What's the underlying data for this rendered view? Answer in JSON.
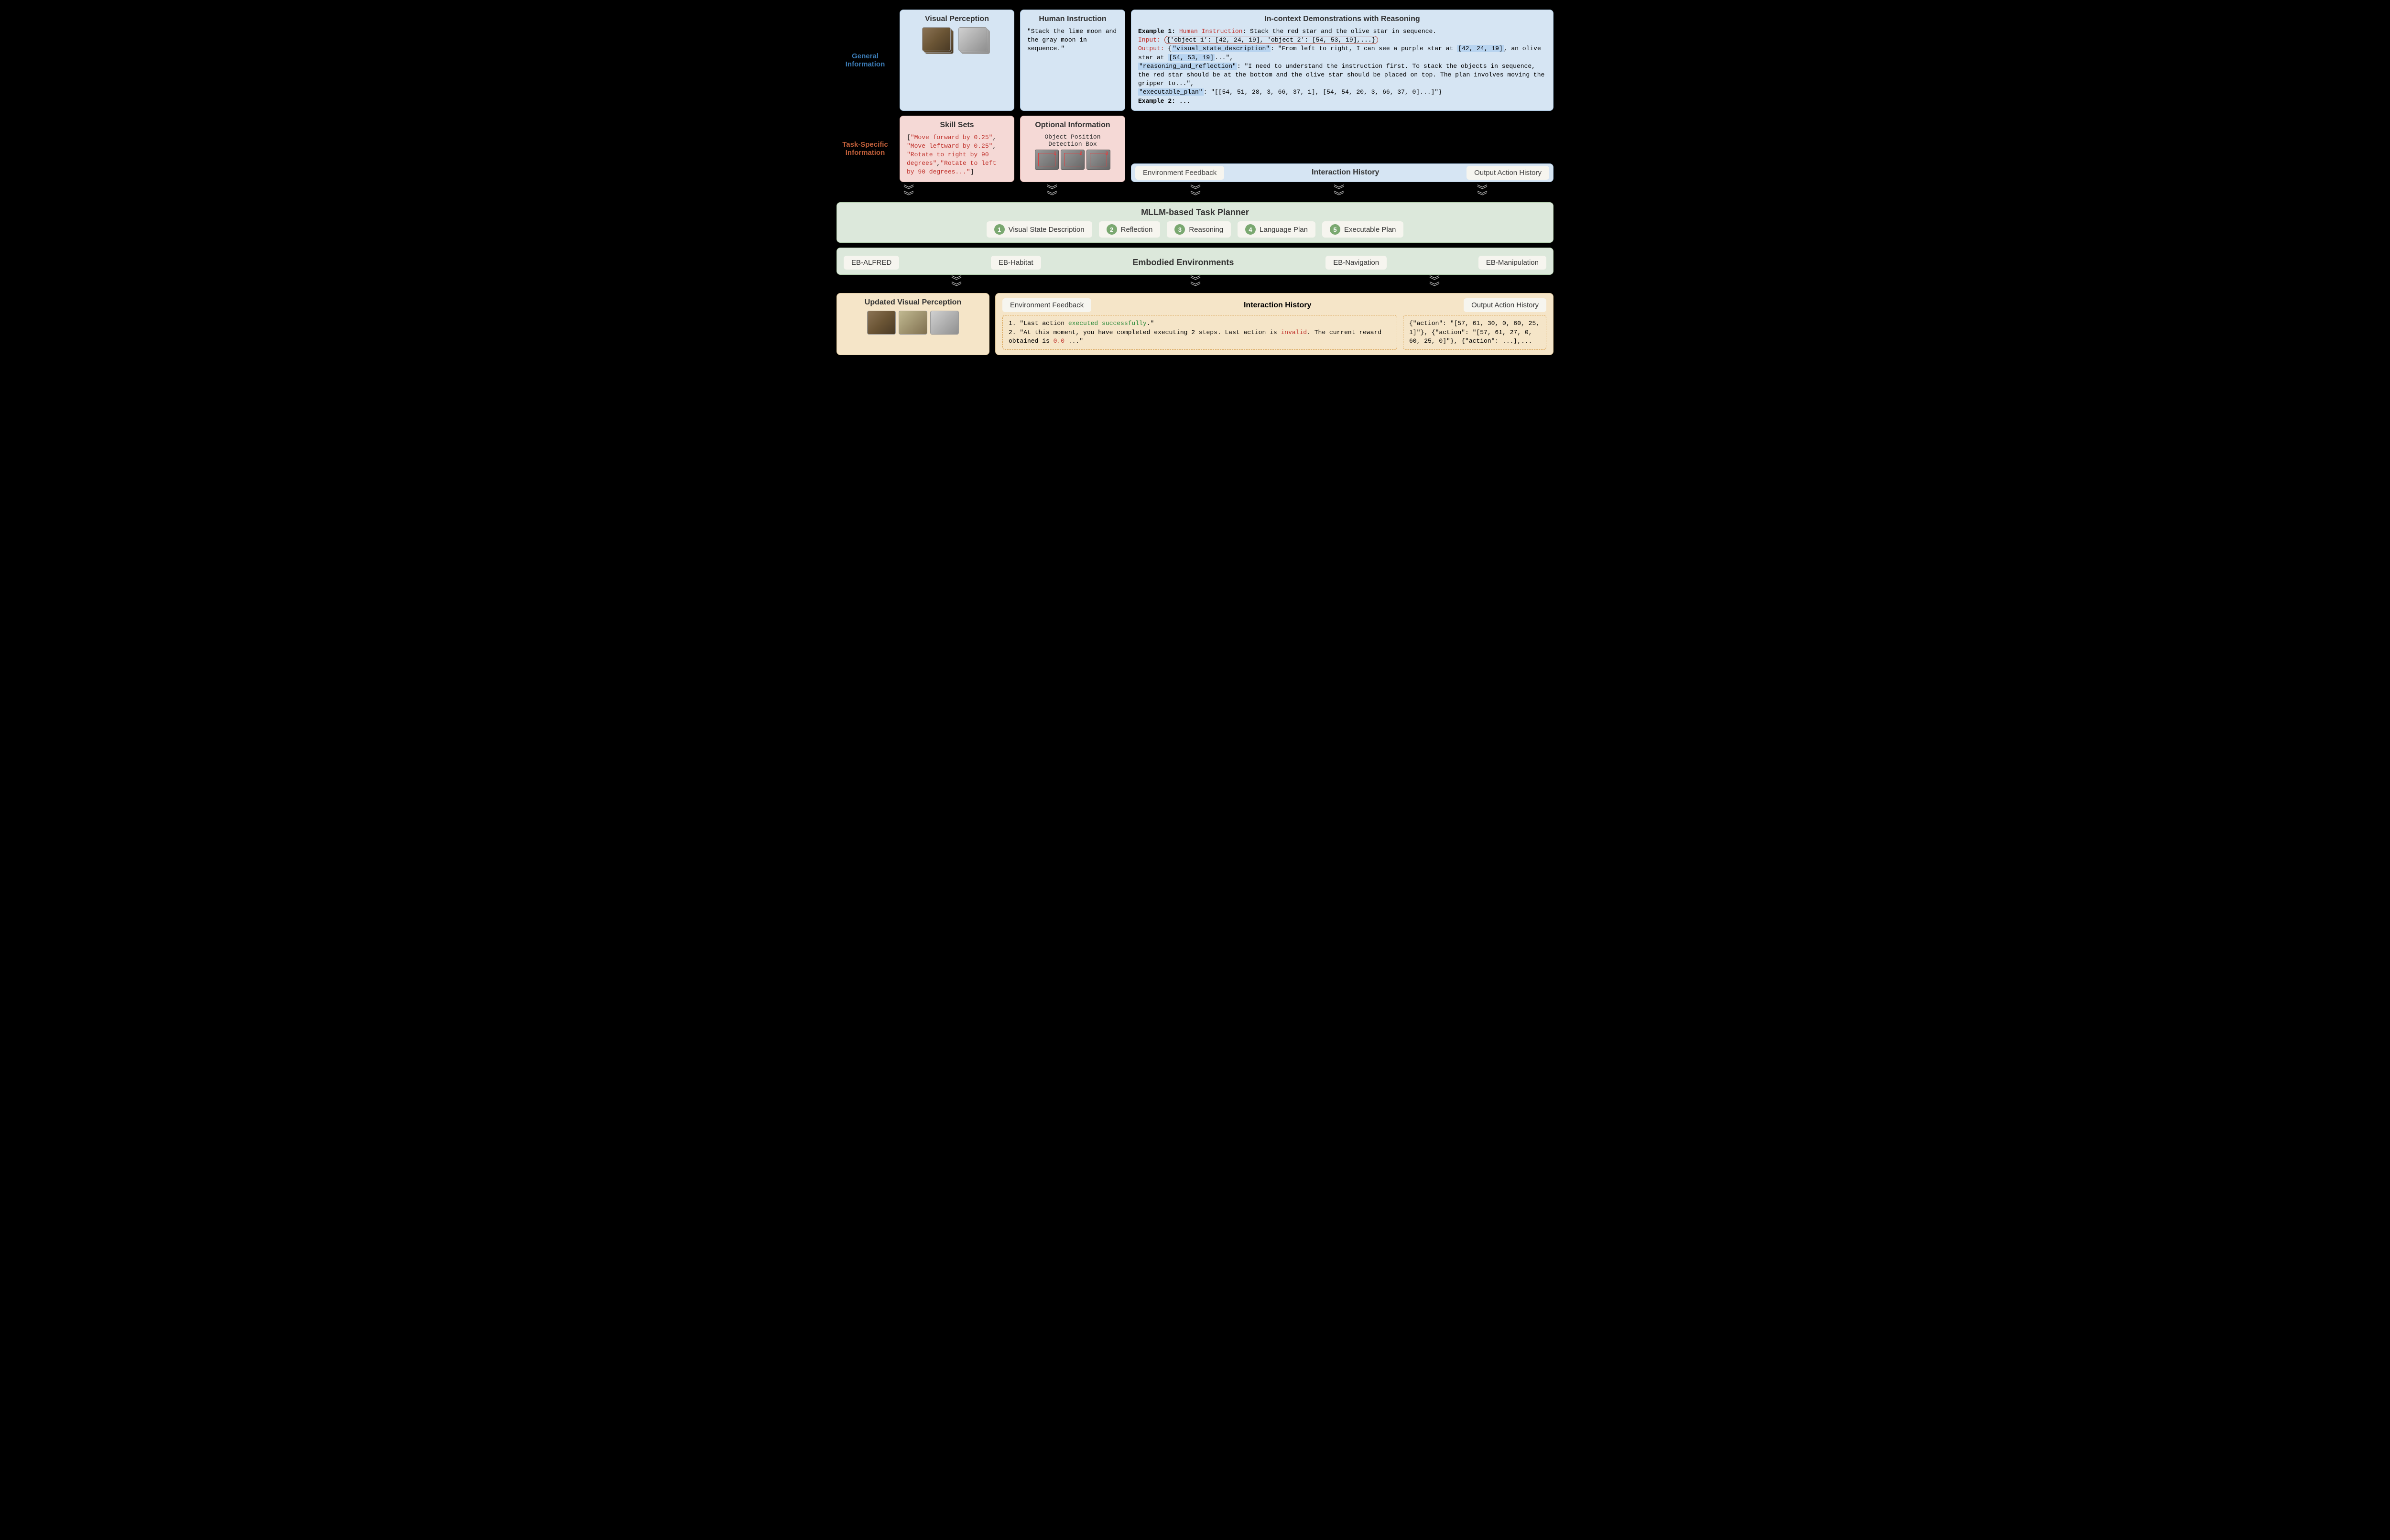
{
  "labels": {
    "general": "General Information",
    "task": "Task-Specific Information"
  },
  "visual_perception": {
    "title": "Visual Perception"
  },
  "human_instruction": {
    "title": "Human Instruction",
    "text": "\"Stack the lime moon and the gray moon in sequence.\""
  },
  "skill_sets": {
    "title": "Skill Sets",
    "code_prefix": "[",
    "items": [
      "\"Move forward by 0.25\"",
      "\"Move leftward by 0.25\"",
      "\"Rotate to right by 90 degrees\"",
      "\"Rotate to left by 90 degrees...\""
    ],
    "code_suffix": "]"
  },
  "optional_info": {
    "title": "Optional Information",
    "line1": "Object Position",
    "line2": "Detection Box"
  },
  "demonstrations": {
    "title": "In-context Demonstrations with Reasoning",
    "ex1_label": "Example 1:",
    "hi_label": "Human Instruction",
    "hi_text": ": Stack the red star and the olive star in sequence.",
    "input_label": "Input:",
    "input_text": "{'object 1': [42, 24, 19], 'object 2': [54, 53, 19],...}",
    "output_label": "Output:",
    "vsd_key": "\"visual_state_description\"",
    "vsd_text_a": ": \"From left to right, I can see a purple star at ",
    "vsd_hl1": "[42, 24, 19]",
    "vsd_text_b": ", an olive star at ",
    "vsd_hl2": "[54, 53, 19]",
    "vsd_text_c": "...\",",
    "rr_key": "\"reasoning_and_reflection\"",
    "rr_text": ": \"I need to understand the instruction first. To stack the objects in sequence, the red star should be at the bottom and the olive star should be placed on top. The plan involves moving the gripper to...\",",
    "ep_key": "\"executable_plan\"",
    "ep_text": ": \"[[54, 51, 28, 3, 66, 37, 1], [54, 54, 20, 3, 66, 37, 0]...]\"",
    "ex2": "Example 2: ..."
  },
  "history_top": {
    "feedback": "Environment Feedback",
    "title": "Interaction History",
    "actions": "Output Action History"
  },
  "planner": {
    "title": "MLLM-based Task Planner",
    "steps": [
      "Visual State Description",
      "Reflection",
      "Reasoning",
      "Language Plan",
      "Executable Plan"
    ]
  },
  "environments": {
    "title": "Embodied Environments",
    "envs": [
      "EB-ALFRED",
      "EB-Habitat",
      "EB-Navigation",
      "EB-Manipulation"
    ]
  },
  "updated_vp": {
    "title": "Updated Visual Perception"
  },
  "history_bottom": {
    "feedback": "Environment Feedback",
    "title": "Interaction History",
    "actions": "Output Action History",
    "fb_line1_a": "1. \"Last action ",
    "fb_line1_b": "executed successfully",
    "fb_line1_c": ".\"",
    "fb_line2_a": "2. \"At this moment, you have completed executing 2 steps. Last action is ",
    "fb_line2_b": "invalid",
    "fb_line2_c": ". The current reward obtained is ",
    "fb_line2_d": "0.0",
    "fb_line2_e": " ...\"",
    "action_text": "{\"action\": \"[57, 61, 30, 0, 60, 25, 1]\"}, {\"action\": \"[57, 61, 27, 0, 60, 25, 0]\"}, {\"action\": ...},..."
  }
}
